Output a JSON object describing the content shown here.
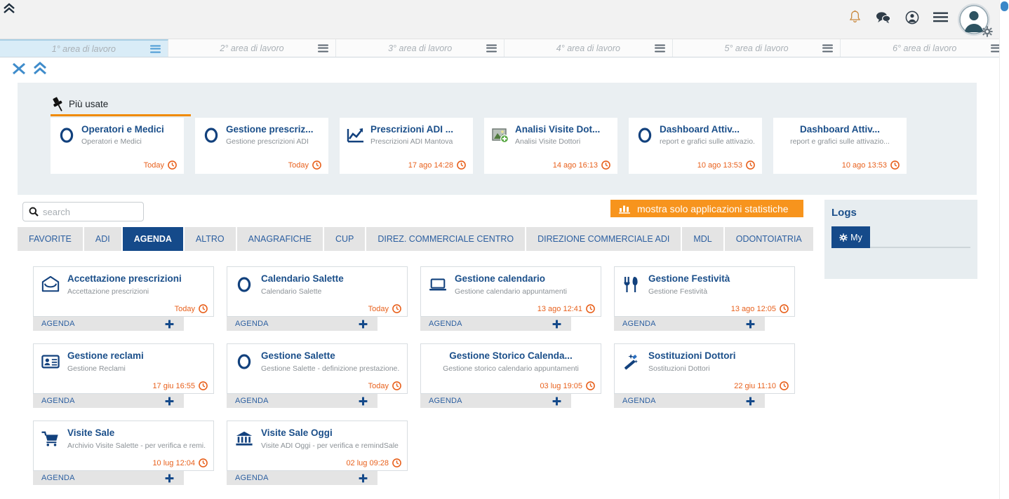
{
  "header": {
    "collapse_icon": "chevron-up-icon",
    "icons": [
      {
        "name": "bell-icon",
        "label": "Notifiche"
      },
      {
        "name": "chat-icon",
        "label": "Messaggi"
      },
      {
        "name": "user-circle-icon",
        "label": "Profilo"
      },
      {
        "name": "hamburger-menu-icon",
        "label": "Menu"
      }
    ],
    "avatar": {
      "name": "avatar",
      "gear": "gear-icon"
    }
  },
  "work_areas": [
    {
      "label": "1° area di lavoro",
      "active": true
    },
    {
      "label": "2° area di lavoro",
      "active": false
    },
    {
      "label": "3° area di lavoro",
      "active": false
    },
    {
      "label": "4° area di lavoro",
      "active": false
    },
    {
      "label": "5° area di lavoro",
      "active": false
    },
    {
      "label": "6° area di lavoro",
      "active": false
    }
  ],
  "toolbar": {
    "close_icon": "close-x-icon",
    "collapse_icon": "double-chevron-up-icon"
  },
  "most_used": {
    "title": "Più usate",
    "pin_icon": "pin-icon",
    "accent_color": "#f08a00",
    "cards": [
      {
        "title": "Operatori e Medici",
        "subtitle": "Operatori e Medici",
        "time": "Today",
        "icon": "circle-icon"
      },
      {
        "title": "Gestione prescriz...",
        "subtitle": "Gestione prescrizioni ADI",
        "time": "Today",
        "icon": "circle-icon"
      },
      {
        "title": "Prescrizioni ADI ...",
        "subtitle": "Prescrizioni ADI Mantova",
        "time": "17 ago 14:28",
        "icon": "chart-line-icon"
      },
      {
        "title": "Analisi Visite Dot...",
        "subtitle": "Analisi Visite Dottori",
        "time": "14 ago 16:13",
        "icon": "image-add-icon"
      },
      {
        "title": "Dashboard Attiv...",
        "subtitle": "report e grafici sulle attivazio...",
        "time": "10 ago 13:53",
        "icon": "circle-icon"
      },
      {
        "title": "Dashboard Attiv...",
        "subtitle": "report e grafici sulle attivazio...",
        "time": "10 ago 13:53",
        "icon": "none"
      }
    ]
  },
  "search": {
    "placeholder": "search",
    "value": "",
    "icon": "search-icon"
  },
  "stats_button": {
    "label": "mostra solo applicazioni statistiche",
    "icon": "bar-chart-icon",
    "color": "#f7941d"
  },
  "tabs": [
    {
      "label": "FAVORITE",
      "active": false
    },
    {
      "label": "ADI",
      "active": false
    },
    {
      "label": "AGENDA",
      "active": true
    },
    {
      "label": "ALTRO",
      "active": false
    },
    {
      "label": "ANAGRAFICHE",
      "active": false
    },
    {
      "label": "CUP",
      "active": false
    },
    {
      "label": "DIREZ. COMMERCIALE CENTRO",
      "active": false
    },
    {
      "label": "DIREZIONE COMMERCIALE ADI",
      "active": false
    },
    {
      "label": "MDL",
      "active": false
    },
    {
      "label": "ODONTOIATRIA",
      "active": false
    }
  ],
  "apps": [
    {
      "title": "Accettazione prescrizioni",
      "subtitle": "Accettazione prescrizioni",
      "time": "Today",
      "category": "AGENDA",
      "icon": "envelope-icon"
    },
    {
      "title": "Calendario Salette",
      "subtitle": "Calendario Salette",
      "time": "Today",
      "category": "AGENDA",
      "icon": "circle-icon"
    },
    {
      "title": "Gestione calendario",
      "subtitle": "Gestione calendario appuntamenti",
      "time": "13 ago 12:41",
      "category": "AGENDA",
      "icon": "laptop-icon"
    },
    {
      "title": "Gestione Festività",
      "subtitle": "Gestione Festività",
      "time": "13 ago 12:05",
      "category": "AGENDA",
      "icon": "cutlery-icon"
    },
    {
      "title": "Gestione reclami",
      "subtitle": "Gestione Reclami",
      "time": "17 giu 16:55",
      "category": "AGENDA",
      "icon": "id-card-icon"
    },
    {
      "title": "Gestione Salette",
      "subtitle": "Gestione Salette - definizione prestazione...",
      "time": "Today",
      "category": "AGENDA",
      "icon": "circle-icon"
    },
    {
      "title": "Gestione Storico Calenda...",
      "subtitle": "Gestione storico calendario appuntamenti",
      "time": "03 lug 19:05",
      "category": "AGENDA",
      "icon": "none"
    },
    {
      "title": "Sostituzioni Dottori",
      "subtitle": "Sostituzioni Dottori",
      "time": "22 giu 11:10",
      "category": "AGENDA",
      "icon": "magic-wand-icon"
    },
    {
      "title": "Visite Sale",
      "subtitle": "Archivio Visite Salette - per verifica e remi...",
      "time": "10 lug 12:04",
      "category": "AGENDA",
      "icon": "shopping-cart-icon"
    },
    {
      "title": "Visite Sale Oggi",
      "subtitle": "Visite ADI Oggi - per verifica e remindSale",
      "time": "02 lug 09:28",
      "category": "AGENDA",
      "icon": "bank-icon"
    }
  ],
  "card_footer": {
    "add_icon": "plus-icon"
  },
  "logs": {
    "title": "Logs",
    "tabs": [
      {
        "label": "My",
        "icon": "gear-icon",
        "active": true
      }
    ]
  },
  "colors": {
    "primary_blue": "#154a8a",
    "link_blue": "#1b4f8a",
    "orange": "#e8611d",
    "accent_orange": "#f7941d"
  }
}
